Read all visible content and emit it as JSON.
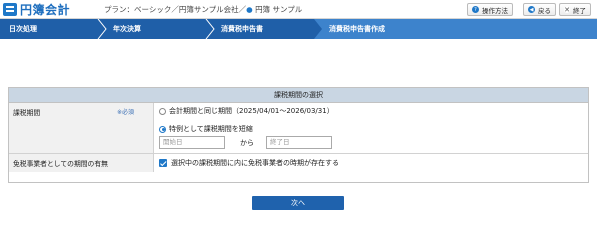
{
  "app": {
    "logo_text": "円簿会計"
  },
  "header": {
    "plan_text": "プラン：ベーシック／円簿サンプル会社／",
    "company_dot": "●",
    "company_name": "円簿 サンプル",
    "buttons": {
      "help": "操作方法",
      "back": "戻る",
      "close": "終了"
    }
  },
  "nav": {
    "steps": [
      {
        "label": "日次処理"
      },
      {
        "label": "年次決算"
      },
      {
        "label": "消費税申告書"
      },
      {
        "label": "消費税申告書作成"
      }
    ],
    "active_index": 3
  },
  "panel": {
    "title": "課税期間の選択",
    "period": {
      "label": "課税期間",
      "required": "※必須",
      "option1": "会計期間と同じ期間（2025/04/01〜2026/03/31）",
      "option2": "特例として課税期間を短縮",
      "selected": "option2",
      "start_placeholder": "開始日",
      "end_placeholder": "終了日",
      "separator": "から"
    },
    "exempt": {
      "label": "免税事業者としての期間の有無",
      "checkbox_label": "選択中の課税期間に内に免税事業者の時期が存在する",
      "checked": true
    }
  },
  "footer": {
    "next_label": "次へ"
  },
  "colors": {
    "nav": "#1f5fa8",
    "nav_active": "#3d83cc",
    "accent": "#1f78c8",
    "panel_title_bg": "#c9d6e3"
  }
}
